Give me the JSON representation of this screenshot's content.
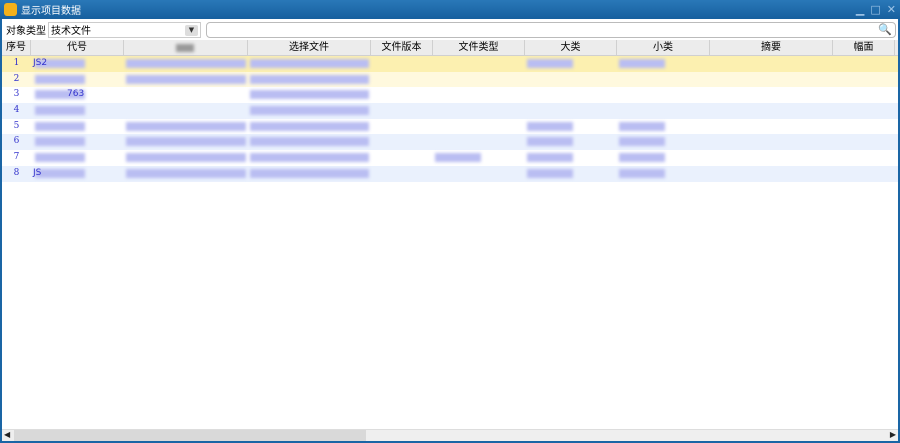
{
  "window": {
    "title": "显示项目数据",
    "min": "▁",
    "max": "□",
    "close": "✕",
    "logo": "P"
  },
  "toolbar": {
    "type_label": "对象类型",
    "type_value": "技术文件",
    "search_value": ""
  },
  "columns": [
    "序号",
    "代号",
    "",
    "选择文件",
    "文件版本",
    "文件类型",
    "大类",
    "小类",
    "摘要",
    "幅面"
  ],
  "rows": [
    {
      "n": "1",
      "code": "JS2"
    },
    {
      "n": "2",
      "code": ""
    },
    {
      "n": "3",
      "code": "763"
    },
    {
      "n": "4",
      "code": ""
    },
    {
      "n": "5",
      "code": ""
    },
    {
      "n": "6",
      "code": ""
    },
    {
      "n": "7",
      "code": ""
    },
    {
      "n": "8",
      "code": "JS"
    }
  ]
}
